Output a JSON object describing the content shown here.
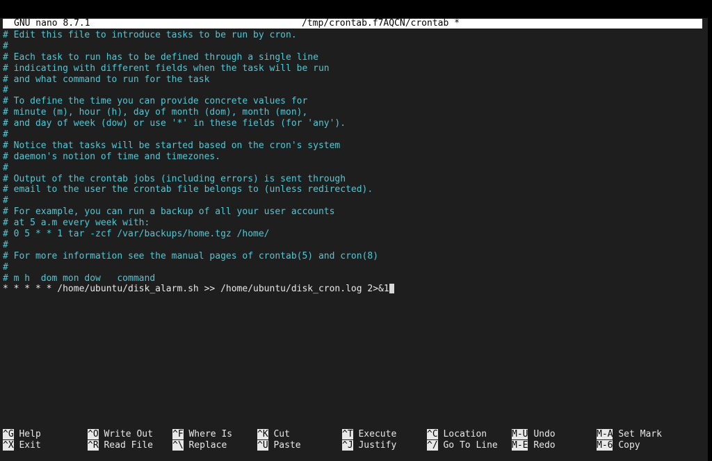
{
  "titlebar": {
    "version": "GNU nano 8.7.1",
    "filename": "/tmp/crontab.f7AQCN/crontab *"
  },
  "editor": {
    "lines": [
      "# Edit this file to introduce tasks to be run by cron.",
      "#",
      "# Each task to run has to be defined through a single line",
      "# indicating with different fields when the task will be run",
      "# and what command to run for the task",
      "#",
      "# To define the time you can provide concrete values for",
      "# minute (m), hour (h), day of month (dom), month (mon),",
      "# and day of week (dow) or use '*' in these fields (for 'any').",
      "#",
      "# Notice that tasks will be started based on the cron's system",
      "# daemon's notion of time and timezones.",
      "#",
      "# Output of the crontab jobs (including errors) is sent through",
      "# email to the user the crontab file belongs to (unless redirected).",
      "#",
      "# For example, you can run a backup of all your user accounts",
      "# at 5 a.m every week with:",
      "# 0 5 * * 1 tar -zcf /var/backups/home.tgz /home/",
      "#",
      "# For more information see the manual pages of crontab(5) and cron(8)",
      "#",
      "# m h  dom mon dow   command"
    ],
    "cron_entry": "* * * * * /home/ubuntu/disk_alarm.sh >> /home/ubuntu/disk_cron.log 2>&1"
  },
  "shortcuts": {
    "help": {
      "key": "^G",
      "label": "Help"
    },
    "exit": {
      "key": "^X",
      "label": "Exit"
    },
    "write_out": {
      "key": "^O",
      "label": "Write Out"
    },
    "read_file": {
      "key": "^R",
      "label": "Read File"
    },
    "where_is": {
      "key": "^F",
      "label": "Where Is"
    },
    "replace": {
      "key": "^\\",
      "label": "Replace"
    },
    "cut": {
      "key": "^K",
      "label": "Cut"
    },
    "paste": {
      "key": "^U",
      "label": "Paste"
    },
    "execute": {
      "key": "^T",
      "label": "Execute"
    },
    "justify": {
      "key": "^J",
      "label": "Justify"
    },
    "location": {
      "key": "^C",
      "label": "Location"
    },
    "go_to_line": {
      "key": "^/",
      "label": "Go To Line"
    },
    "undo": {
      "key": "M-U",
      "label": "Undo"
    },
    "redo": {
      "key": "M-E",
      "label": "Redo"
    },
    "set_mark": {
      "key": "M-A",
      "label": "Set Mark"
    },
    "copy": {
      "key": "M-6",
      "label": "Copy"
    }
  },
  "colors": {
    "comment": "#4fc9d6",
    "text": "#e8e8e8",
    "background": "#1e1e1e",
    "titlebar_bg": "#ffffff"
  }
}
